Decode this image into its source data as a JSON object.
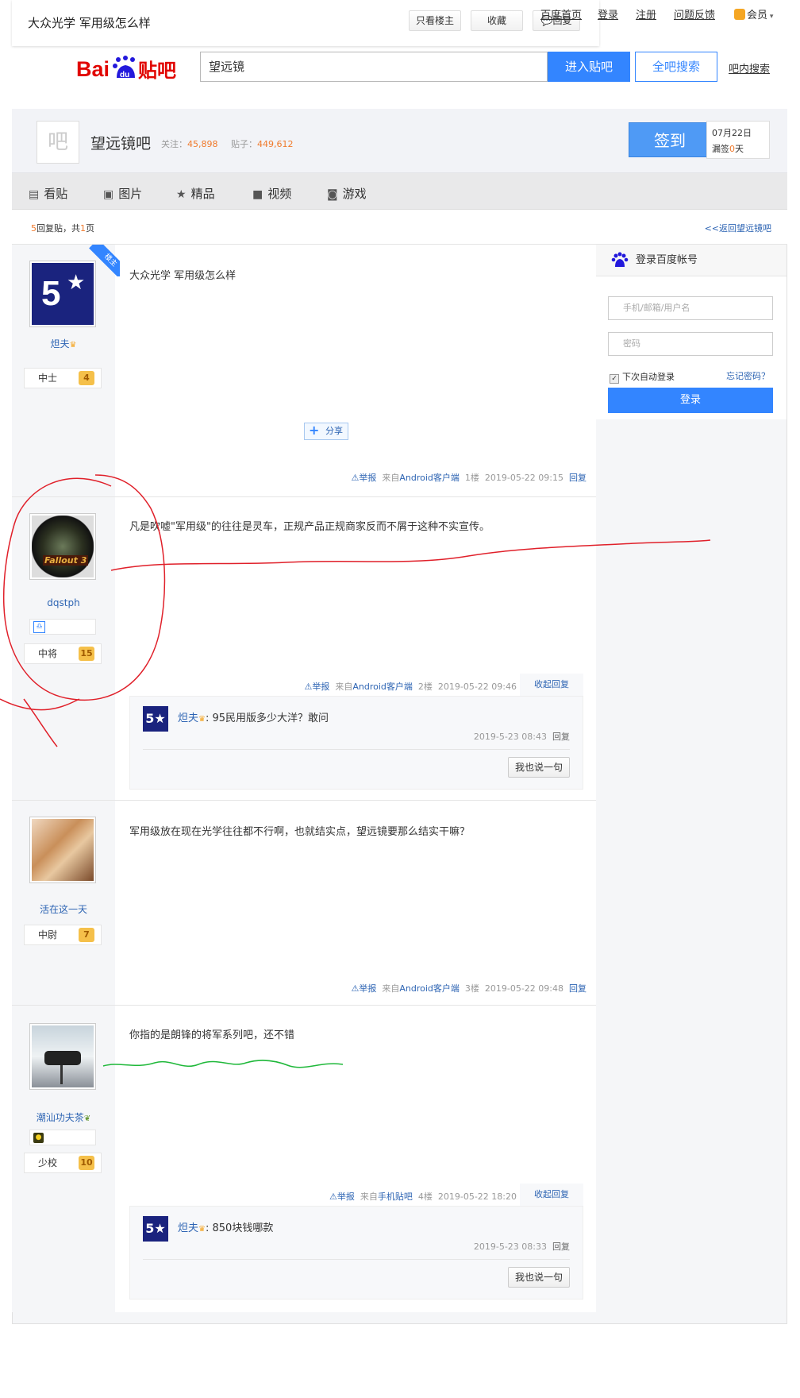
{
  "topbar": {
    "title": "大众光学 军用级怎么样",
    "only_owner": "只看楼主",
    "favorite": "收藏",
    "reply": "回复"
  },
  "globalnav": {
    "home": "百度首页",
    "login": "登录",
    "register": "注册",
    "feedback": "问题反馈",
    "member": "会员"
  },
  "search": {
    "query": "望远镜",
    "enter_label": "进入贴吧",
    "all_label": "全吧搜索",
    "inbar_label": "吧内搜索"
  },
  "forum": {
    "icon_text": "吧",
    "name": "望远镜吧",
    "follow_label": "关注：",
    "follow_count": "45,898",
    "post_label": "贴子：",
    "post_count": "449,612",
    "sign_label": "签到",
    "sign_date": "07月22日",
    "sign_miss_a": "漏签",
    "sign_miss_n": "0",
    "sign_miss_b": "天"
  },
  "tabs": [
    {
      "label": "看贴",
      "icon": "doc-icon"
    },
    {
      "label": "图片",
      "icon": "image-icon"
    },
    {
      "label": "精品",
      "icon": "star-icon"
    },
    {
      "label": "视频",
      "icon": "video-icon"
    },
    {
      "label": "游戏",
      "icon": "gamepad-icon"
    }
  ],
  "info": {
    "reply_count": "5",
    "reply_label": "回复贴，共",
    "page_count": "1",
    "page_label": "页",
    "back_link": "<<返回望远镜吧"
  },
  "posts": [
    {
      "user": "炟夫",
      "rank": "中士",
      "level": "4",
      "content": "大众光学 军用级怎么样",
      "share": "分享",
      "owner_badge": "楼主",
      "report": "举报",
      "source_prefix": "来自",
      "source": "Android客户端",
      "floor": "1楼",
      "time": "2019-05-22 09:15",
      "reply": "回复"
    },
    {
      "user": "dqstph",
      "rank": "中将",
      "level": "15",
      "content": "凡是吹嘘\"军用级\"的往往是灵车，正规产品正规商家反而不屑于这种不实宣传。",
      "report": "举报",
      "source_prefix": "来自",
      "source": "Android客户端",
      "floor": "2楼",
      "time": "2019-05-22 09:46",
      "reply": "收起回复",
      "lzl": {
        "user": "炟夫",
        "text": "95民用版多少大洋？敢问",
        "time": "2019-5-23 08:43",
        "reply": "回复",
        "say": "我也说一句"
      }
    },
    {
      "user": "活在这一天",
      "rank": "中尉",
      "level": "7",
      "content": "军用级放在现在光学往往都不行啊，也就结实点，望远镜要那么结实干嘛？",
      "report": "举报",
      "source_prefix": "来自",
      "source": "Android客户端",
      "floor": "3楼",
      "time": "2019-05-22 09:48",
      "reply": "回复"
    },
    {
      "user": "潮汕功夫茶",
      "rank": "少校",
      "level": "10",
      "content": "你指的是朗锋的将军系列吧，还不错",
      "report": "举报",
      "source_prefix": "来自",
      "source": "手机贴吧",
      "floor": "4楼",
      "time": "2019-05-22 18:20",
      "reply": "收起回复",
      "lzl": {
        "user": "炟夫",
        "text": "850块钱哪款",
        "time": "2019-5-23 08:33",
        "reply": "回复",
        "say": "我也说一句"
      }
    }
  ],
  "sidebar": {
    "title": "登录百度帐号",
    "user_placeholder": "手机/邮箱/用户名",
    "pwd_placeholder": "密码",
    "remember": "下次自动登录",
    "forgot": "忘记密码？",
    "login": "登录"
  },
  "colors": {
    "accent": "#3385ff",
    "orange": "#f07a2c",
    "link": "#2d64b3",
    "red_mark": "#e0202a",
    "green_mark": "#1fb83a"
  }
}
